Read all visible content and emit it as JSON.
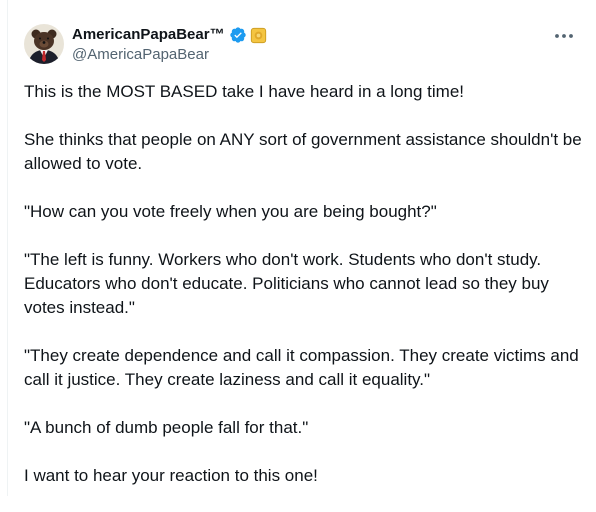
{
  "user": {
    "display_name": "AmericanPapaBear™",
    "handle": "@AmericaPapaBear",
    "verified": true,
    "avatar_icon": "bear-in-suit-avatar",
    "badge_icon": "gold-affiliate-badge-icon"
  },
  "actions": {
    "more_icon": "more-options-icon"
  },
  "tweet": {
    "paragraphs": [
      "This is the MOST BASED take I have heard in a long time!",
      "She thinks that people on ANY sort of government assistance shouldn't be allowed to vote.",
      "\"How can you vote freely when you are being bought?\"",
      "\"The left is funny. Workers who don't work. Students who don't study. Educators who don't educate. Politicians who cannot lead so they buy votes instead.\"",
      "\"They create dependence and call it compassion. They create victims and call it justice. They create laziness and call it equality.\"",
      "\"A bunch of dumb people fall for that.\"",
      "I want to hear your reaction to this one!"
    ]
  },
  "colors": {
    "verified_blue": "#1d9bf0",
    "text_primary": "#0f1419",
    "text_secondary": "#536471"
  }
}
